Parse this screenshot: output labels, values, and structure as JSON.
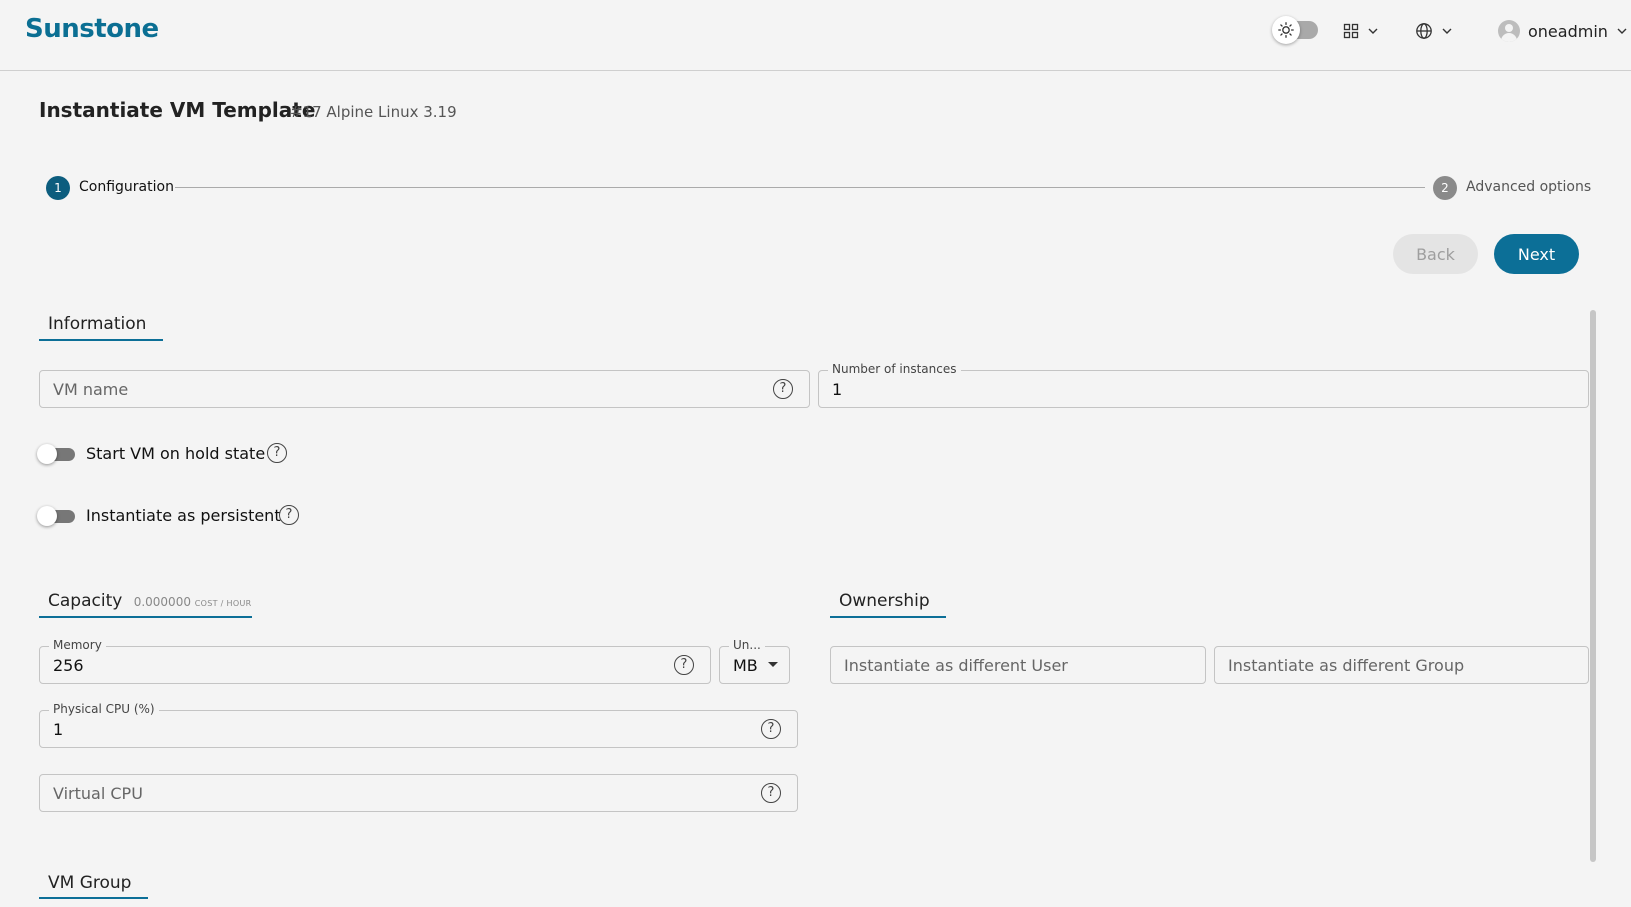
{
  "header": {
    "logo": "Sunstone",
    "user": "oneadmin"
  },
  "page": {
    "title": "Instantiate VM Template",
    "subtitle": "#17 Alpine Linux 3.19"
  },
  "stepper": {
    "steps": [
      {
        "number": "1",
        "label": "Configuration",
        "active": true
      },
      {
        "number": "2",
        "label": "Advanced options",
        "active": false
      }
    ]
  },
  "buttons": {
    "back": "Back",
    "next": "Next"
  },
  "information": {
    "title": "Information",
    "vm_name_placeholder": "VM name",
    "instances_label": "Number of instances",
    "instances_value": "1",
    "hold_label": "Start VM on hold state",
    "persistent_label": "Instantiate as persistent"
  },
  "capacity": {
    "title": "Capacity",
    "cost_value": "0.000000",
    "cost_unit": "COST / HOUR",
    "memory_label": "Memory",
    "memory_value": "256",
    "unit_label": "Un...",
    "unit_value": "MB",
    "pcpu_label": "Physical CPU (%)",
    "pcpu_value": "1",
    "vcpu_placeholder": "Virtual CPU"
  },
  "ownership": {
    "title": "Ownership",
    "user_placeholder": "Instantiate as different User",
    "group_placeholder": "Instantiate as different Group"
  },
  "vm_group": {
    "title": "VM Group"
  },
  "colors": {
    "accent": "#0c6f97",
    "background": "#f4f4f4"
  }
}
